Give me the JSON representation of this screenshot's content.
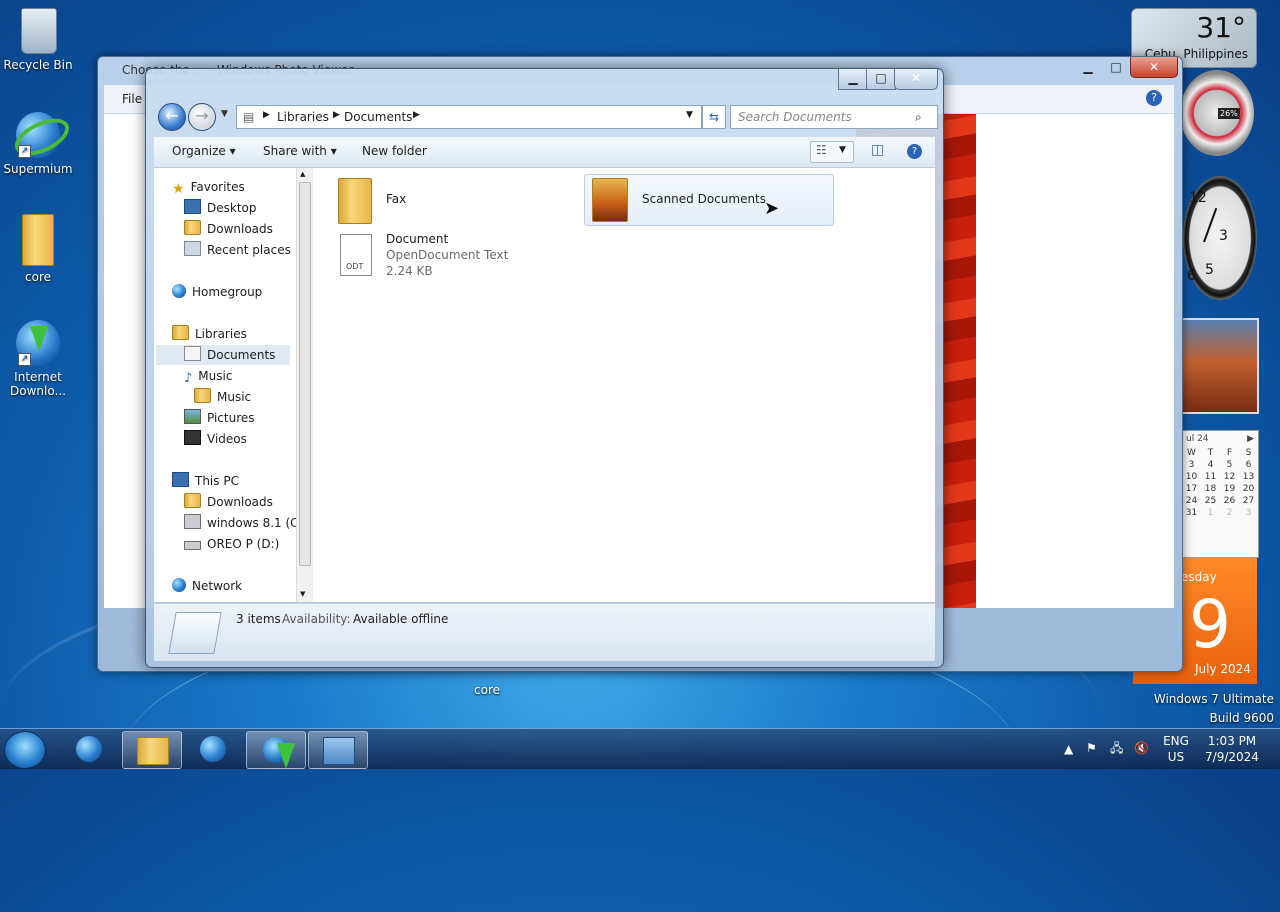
{
  "desktop": {
    "icons": [
      {
        "label": "Recycle Bin"
      },
      {
        "label": "Supermium"
      },
      {
        "label": "core"
      },
      {
        "label": "Internet Downlo..."
      }
    ],
    "drag_label": "core",
    "watermark_line1": "Windows 7 Ultimate",
    "watermark_line2": "Build 9600"
  },
  "gadgets": {
    "weather_temp": "31°",
    "weather_city": "Cebu, Philippines",
    "meter_value": "26%",
    "calendar_header": "ul 24",
    "calendar_days": [
      "W",
      "T",
      "F",
      "S"
    ],
    "calendar_rows": [
      [
        "3",
        "4",
        "5",
        "6"
      ],
      [
        "10",
        "11",
        "12",
        "13"
      ],
      [
        "17",
        "18",
        "19",
        "20"
      ],
      [
        "24",
        "25",
        "26",
        "27"
      ],
      [
        "31",
        "1",
        "2",
        "3"
      ]
    ],
    "calendar_weekday": "esday",
    "calendar_day": "9",
    "calendar_month": "July 2024"
  },
  "photo_viewer": {
    "title": "Choose the ... - Windows Photo Viewer",
    "menu_file": "File"
  },
  "explorer": {
    "breadcrumb": [
      "Libraries",
      "Documents"
    ],
    "search_placeholder": "Search Documents",
    "toolbar": {
      "organize": "Organize",
      "share": "Share with",
      "new_folder": "New folder"
    },
    "nav": {
      "favorites": "Favorites",
      "desktop": "Desktop",
      "downloads": "Downloads",
      "recent": "Recent places",
      "homegroup": "Homegroup",
      "libraries": "Libraries",
      "documents": "Documents",
      "music": "Music",
      "music_sub": "Music",
      "pictures": "Pictures",
      "videos": "Videos",
      "this_pc": "This PC",
      "pc_downloads": "Downloads",
      "drive_c": "windows 8.1 (C:)",
      "drive_d": "OREO P (D:)",
      "network": "Network"
    },
    "items": {
      "fax": "Fax",
      "scanned": "Scanned Documents",
      "doc_name": "Document",
      "doc_type": "OpenDocument Text",
      "doc_size": "2.24 KB",
      "odt_badge": "ODT"
    },
    "status": {
      "count": "3 items",
      "availability_label": "Availability:",
      "availability_value": "Available offline"
    }
  },
  "taskbar": {
    "lang": "ENG",
    "region": "US",
    "time": "1:03 PM",
    "date": "7/9/2024"
  }
}
